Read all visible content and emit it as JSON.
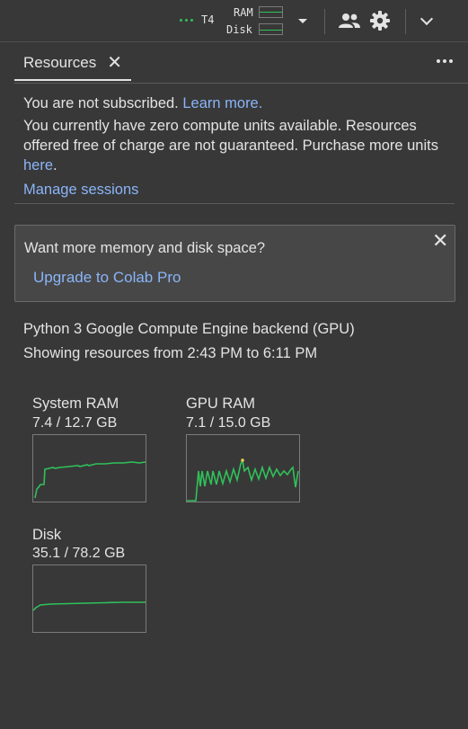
{
  "toolbar": {
    "gpu_label": "T4",
    "ram_label": "RAM",
    "disk_label": "Disk"
  },
  "tabs": [
    {
      "label": "Resources",
      "close": "✕"
    }
  ],
  "subscription": {
    "line1_text": "You are not subscribed.",
    "line1_link": "Learn more.",
    "line2_text": "You currently have zero compute units available. Resources offered free of charge are not guaranteed. Purchase more units",
    "line2_link": "here",
    "line2_end": ".",
    "manage_link": "Manage sessions"
  },
  "promo": {
    "title": "Want more memory and disk space?",
    "link": "Upgrade to Colab Pro",
    "close": "✕"
  },
  "backend": {
    "line1": "Python 3 Google Compute Engine backend (GPU)",
    "line2": "Showing resources from 2:43 PM to 6:11 PM"
  },
  "resources": {
    "system_ram": {
      "title": "System RAM",
      "value": "7.4 / 12.7 GB"
    },
    "gpu_ram": {
      "title": "GPU RAM",
      "value": "7.1 / 15.0 GB"
    },
    "disk": {
      "title": "Disk",
      "value": "35.1 / 78.2 GB"
    }
  },
  "colors": {
    "background": "#383838",
    "link": "#8ab4f8",
    "chart_line": "#30c15a",
    "chart_peak": "#f2c94c"
  }
}
